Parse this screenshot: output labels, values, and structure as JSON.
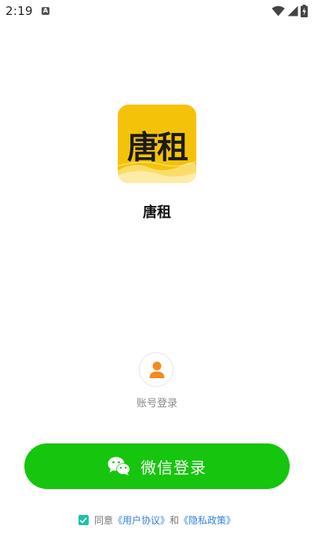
{
  "status_bar": {
    "time": "2:19",
    "notification_icon": "a-badge-icon",
    "icons": [
      "wifi-icon",
      "signal-icon",
      "battery-charging-icon"
    ]
  },
  "app": {
    "logo_text": "唐租",
    "name": "唐租",
    "brand_color": "#f5c20a"
  },
  "account_login": {
    "icon": "user-icon",
    "label": "账号登录"
  },
  "wechat_login": {
    "icon": "wechat-icon",
    "label": "微信登录",
    "color": "#16c50e"
  },
  "agreement": {
    "checked": true,
    "prefix": "同意",
    "user_agreement": "《用户协议》",
    "conjunction": "和",
    "privacy_policy": "《隐私政策》"
  }
}
